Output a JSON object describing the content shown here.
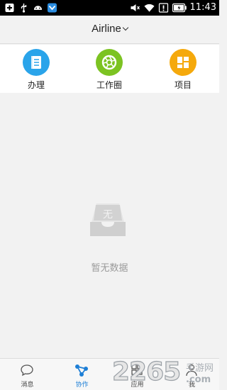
{
  "status_bar": {
    "time": "11:43",
    "icons": [
      "plus-icon",
      "usb-icon",
      "android-icon",
      "app-badge-icon",
      "mute-icon",
      "wifi-icon",
      "alert-icon",
      "battery-icon"
    ]
  },
  "header": {
    "title": "Airline"
  },
  "features": [
    {
      "label": "办理",
      "icon": "document-icon",
      "color": "#2aa4ea"
    },
    {
      "label": "工作圈",
      "icon": "aperture-icon",
      "color": "#7cc322"
    },
    {
      "label": "项目",
      "icon": "grid-icon",
      "color": "#f5a90c"
    }
  ],
  "empty": {
    "glyph": "无",
    "message": "暂无数据"
  },
  "tabs": [
    {
      "label": "消息",
      "icon": "chat-icon",
      "active": false
    },
    {
      "label": "协作",
      "icon": "network-icon",
      "active": true
    },
    {
      "label": "应用",
      "icon": "apps-icon",
      "active": false
    },
    {
      "label": "我",
      "icon": "person-icon",
      "active": false
    }
  ],
  "watermark": {
    "number": "2265",
    "suffix": ".com",
    "tag": "手游网"
  },
  "colors": {
    "accent": "#1e7fd6",
    "background": "#f2f2f2",
    "muted_text": "#9a9a9a"
  }
}
